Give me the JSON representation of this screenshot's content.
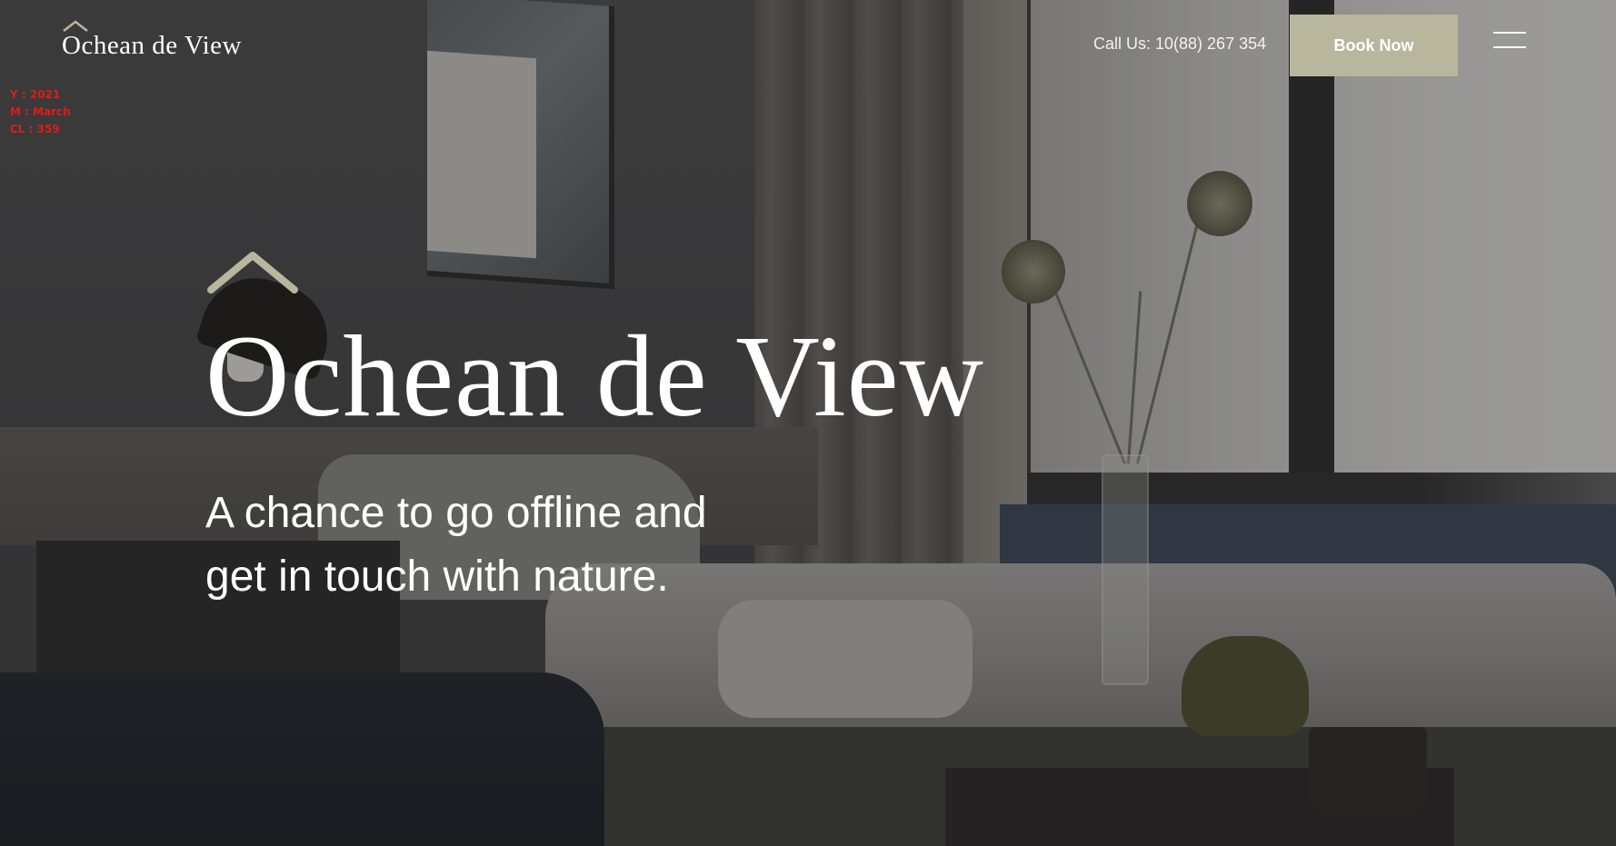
{
  "header": {
    "logo_text": "Ochean de View",
    "phone_text": "Call Us: 10(88) 267 354",
    "book_label": "Book Now",
    "menu_icon": "hamburger-menu-icon"
  },
  "stamp": {
    "year": "Y : 2021",
    "month": "M : March",
    "cl": "CL : 359"
  },
  "hero": {
    "title": "Ochean de View",
    "subtitle_line1": "A chance to go offline and",
    "subtitle_line2": "get in touch with nature."
  },
  "colors": {
    "accent": "#b8b69c",
    "stamp": "#e01b1b",
    "text": "#ffffff"
  }
}
